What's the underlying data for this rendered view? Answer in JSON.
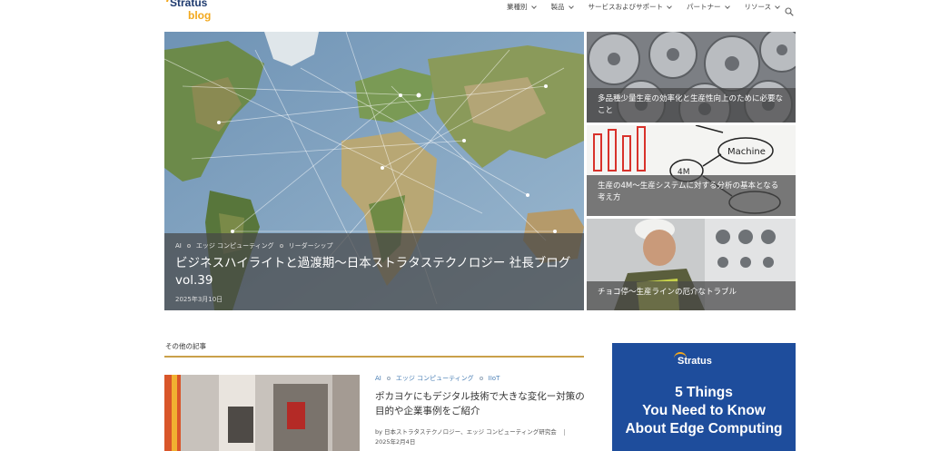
{
  "header": {
    "logo_top": "Stratus",
    "logo_bottom": "blog",
    "nav": [
      {
        "label": "業種別"
      },
      {
        "label": "製品"
      },
      {
        "label": "サービスおよびサポート"
      },
      {
        "label": "パートナー"
      },
      {
        "label": "リソース"
      }
    ]
  },
  "featured": {
    "main": {
      "categories": [
        "AI",
        "エッジ コンピューティング",
        "リーダーシップ"
      ],
      "title": "ビジネスハイライトと過渡期〜日本ストラタステクノロジー 社長ブログ vol.39",
      "date": "2025年3月10日"
    },
    "side": [
      {
        "title": "多品種少量生産の効率化と生産性向上のために必要なこと"
      },
      {
        "title": "生産の4M〜生産システムに対する分析の基本となる考え方"
      },
      {
        "title": "チョコ停〜生産ラインの厄介なトラブル"
      }
    ]
  },
  "other_posts": {
    "heading": "その他の記事",
    "posts": [
      {
        "categories": [
          "AI",
          "エッジ コンピューティング",
          "IIoT"
        ],
        "title": "ポカヨケにもデジタル技術で大きな変化ー対策の目的や企業事例をご紹介",
        "byline": "by 日本ストラタステクノロジー、エッジ コンピューティング研究会",
        "date": "2025年2月4日"
      }
    ]
  },
  "ad": {
    "brand": "Stratus",
    "lines": [
      "5 Things",
      "You Need to Know",
      "About Edge Computing"
    ]
  },
  "colors": {
    "accent_rule": "#c9a04a",
    "ad_background": "#1e4d9c",
    "category_link": "#4a7fb5",
    "logo_orange": "#f2a81d"
  }
}
